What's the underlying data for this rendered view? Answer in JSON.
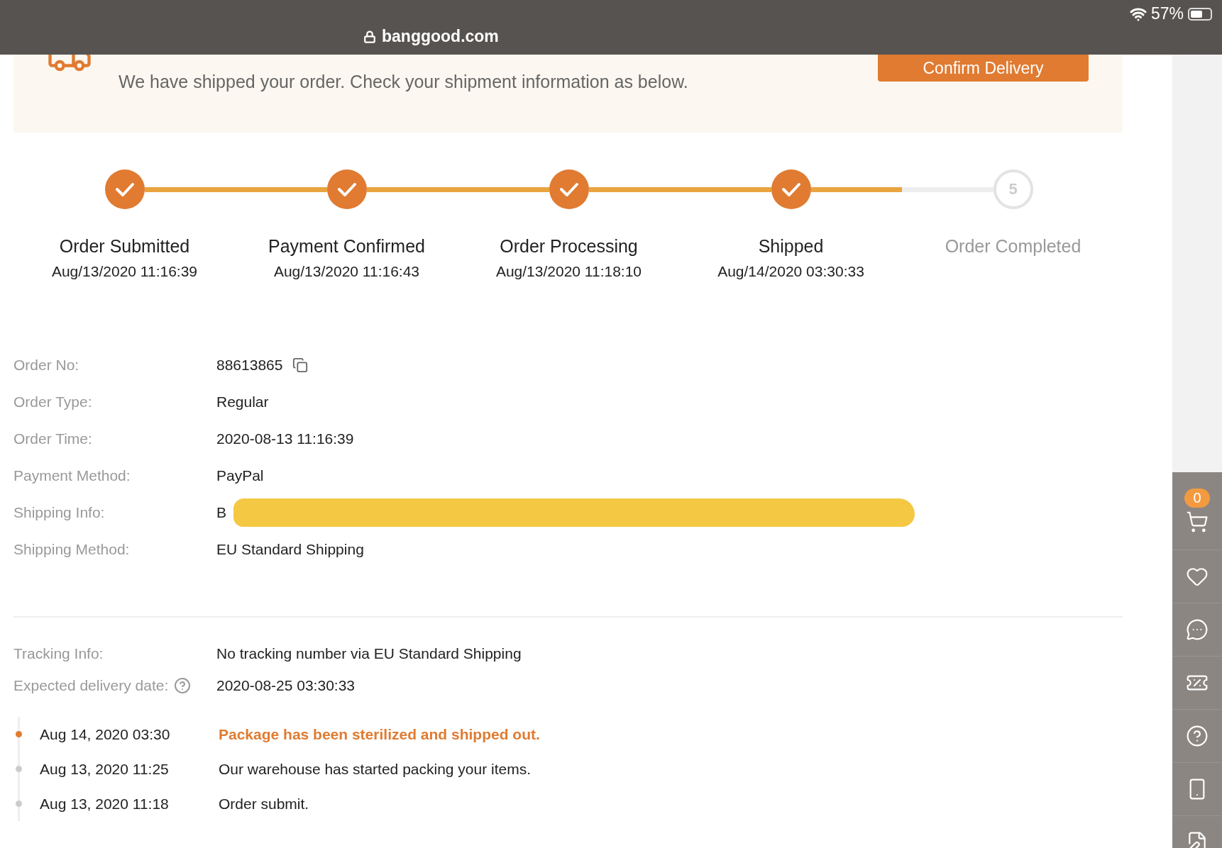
{
  "status_bar": {
    "url": "banggood.com",
    "battery": "57%"
  },
  "banner": {
    "message": "We have shipped your order. Check your shipment information as below.",
    "button": "Confirm Delivery"
  },
  "steps": [
    {
      "label": "Order Submitted",
      "date": "Aug/13/2020 11:16:39",
      "done": true
    },
    {
      "label": "Payment Confirmed",
      "date": "Aug/13/2020 11:16:43",
      "done": true
    },
    {
      "label": "Order Processing",
      "date": "Aug/13/2020 11:18:10",
      "done": true
    },
    {
      "label": "Shipped",
      "date": "Aug/14/2020 03:30:33",
      "done": true
    },
    {
      "label": "Order Completed",
      "number": "5",
      "done": false
    }
  ],
  "order_info": [
    {
      "label": "Order No:",
      "value": "88613865",
      "copyable": true
    },
    {
      "label": "Order Type:",
      "value": "Regular"
    },
    {
      "label": "Order Time:",
      "value": "2020-08-13 11:16:39"
    },
    {
      "label": "Payment Method:",
      "value": "PayPal"
    },
    {
      "label": "Shipping Info:",
      "value": "B",
      "redacted": true
    },
    {
      "label": "Shipping Method:",
      "value": "EU Standard Shipping"
    }
  ],
  "tracking": {
    "label": "Tracking Info:",
    "value": "No tracking number via EU Standard Shipping",
    "expected_label": "Expected delivery date:",
    "expected_value": "2020-08-25 03:30:33"
  },
  "timeline": [
    {
      "time": "Aug 14, 2020 03:30",
      "text": "Package has been sterilized and shipped out.",
      "current": true
    },
    {
      "time": "Aug 13, 2020 11:25",
      "text": "Our warehouse has started packing your items.",
      "current": false
    },
    {
      "time": "Aug 13, 2020 11:18",
      "text": "Order submit.",
      "current": false
    }
  ],
  "sidebar": [
    {
      "kind": "cart",
      "badge": "0"
    },
    {
      "kind": "wishlist"
    },
    {
      "kind": "chat"
    },
    {
      "kind": "coupon"
    },
    {
      "kind": "help"
    },
    {
      "kind": "app"
    },
    {
      "kind": "feedback"
    }
  ]
}
